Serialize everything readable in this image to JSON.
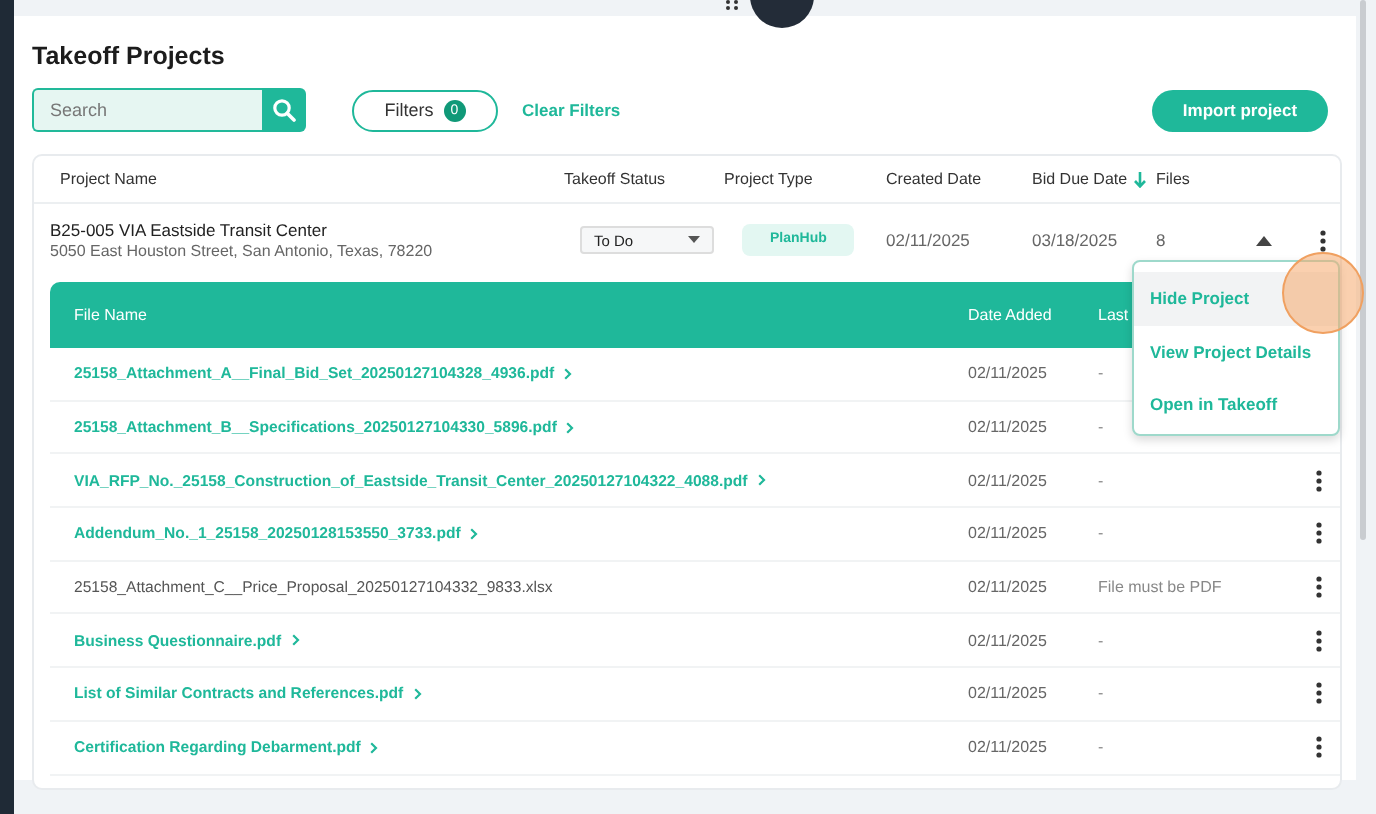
{
  "page": {
    "title": "Takeoff Projects"
  },
  "toolbar": {
    "search": {
      "placeholder": "Search"
    },
    "filters": {
      "label": "Filters",
      "count": "0"
    },
    "clear_filters": "Clear Filters",
    "import_button": "Import project"
  },
  "projects_table": {
    "columns": [
      {
        "label": "Project Name",
        "sorted": false
      },
      {
        "label": "Takeoff Status",
        "sorted": false
      },
      {
        "label": "Project Type",
        "sorted": false
      },
      {
        "label": "Created Date",
        "sorted": false
      },
      {
        "label": "Bid Due Date",
        "sorted": true
      },
      {
        "label": "Files",
        "sorted": false
      }
    ],
    "rows": [
      {
        "name": "B25-005 VIA Eastside Transit Center",
        "address": "5050 East Houston Street, San Antonio, Texas, 78220",
        "status": "To Do",
        "type": "PlanHub",
        "created": "02/11/2025",
        "bid_due": "03/18/2025",
        "files": "8",
        "expanded": true,
        "files_table": {
          "columns": [
            "File Name",
            "Date Added",
            "Last"
          ],
          "rows": [
            {
              "kind": "link",
              "name": "25158_Attachment_A__Final_Bid_Set_20250127104328_4936.pdf",
              "date": "02/11/2025",
              "last": "-",
              "menu_button": false
            },
            {
              "kind": "link",
              "name": "25158_Attachment_B__Specifications_20250127104330_5896.pdf",
              "date": "02/11/2025",
              "last": "-",
              "menu_button": false
            },
            {
              "kind": "link",
              "name": "VIA_RFP_No._25158_Construction_of_Eastside_Transit_Center_20250127104322_4088.pdf",
              "date": "02/11/2025",
              "last": "-",
              "menu_button": true
            },
            {
              "kind": "link",
              "name": "Addendum_No._1_25158_20250128153550_3733.pdf",
              "date": "02/11/2025",
              "last": "-",
              "menu_button": true
            },
            {
              "kind": "plain",
              "name": "25158_Attachment_C__Price_Proposal_20250127104332_9833.xlsx",
              "date": "02/11/2025",
              "last": "File must be PDF",
              "menu_button": true
            },
            {
              "kind": "link",
              "name": "Business Questionnaire.pdf",
              "date": "02/11/2025",
              "last": "-",
              "menu_button": true
            },
            {
              "kind": "link",
              "name": "List of Similar Contracts and References.pdf",
              "date": "02/11/2025",
              "last": "-",
              "menu_button": true
            },
            {
              "kind": "link",
              "name": "Certification Regarding Debarment.pdf",
              "date": "02/11/2025",
              "last": "-",
              "menu_button": true
            }
          ]
        }
      }
    ]
  },
  "context_menu": {
    "items": [
      {
        "label": "Hide Project",
        "highlighted": true
      },
      {
        "label": "View Project Details",
        "highlighted": false
      },
      {
        "label": "Open in Takeoff",
        "highlighted": false
      }
    ]
  }
}
